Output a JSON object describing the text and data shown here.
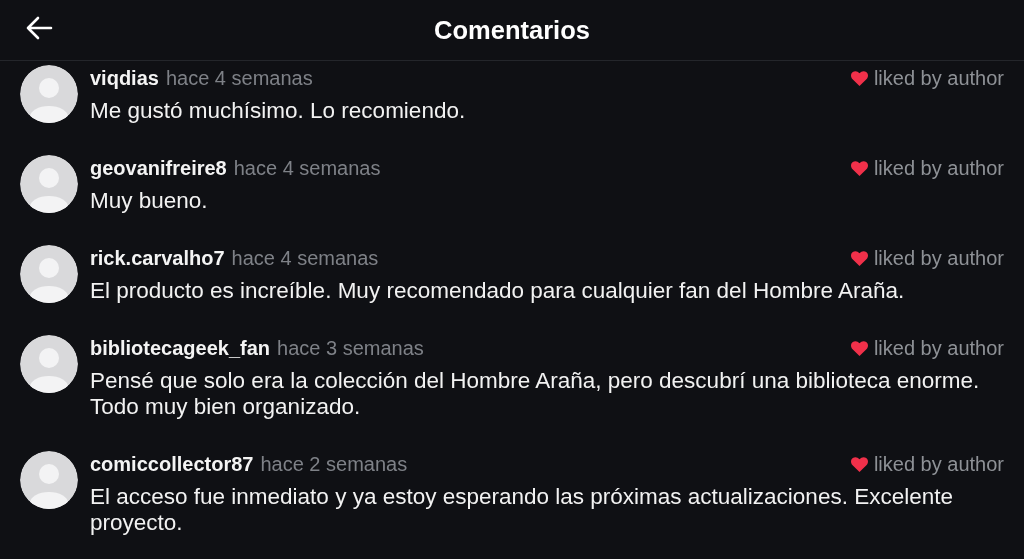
{
  "header": {
    "title": "Comentarios"
  },
  "comments": [
    {
      "username": "viqdias",
      "time": "hace 4 semanas",
      "liked_by_author": true,
      "liked_label": "liked by author",
      "text": "Me gustó muchísimo. Lo recomiendo."
    },
    {
      "username": "geovanifreire8",
      "time": "hace 4 semanas",
      "liked_by_author": true,
      "liked_label": "liked by author",
      "text": "Muy bueno."
    },
    {
      "username": "rick.carvalho7",
      "time": "hace 4 semanas",
      "liked_by_author": true,
      "liked_label": "liked by author",
      "text": "El producto es increíble. Muy recomendado para cualquier fan del Hombre Araña."
    },
    {
      "username": "bibliotecageek_fan",
      "time": "hace 3 semanas",
      "liked_by_author": true,
      "liked_label": "liked by author",
      "text": "Pensé que solo era la colección del Hombre Araña, pero descubrí una biblioteca enorme. Todo muy bien organizado."
    },
    {
      "username": "comiccollector87",
      "time": "hace 2 semanas",
      "liked_by_author": true,
      "liked_label": "liked by author",
      "text": "El acceso fue inmediato y ya estoy esperando las próximas actualizaciones. Excelente proyecto."
    }
  ]
}
